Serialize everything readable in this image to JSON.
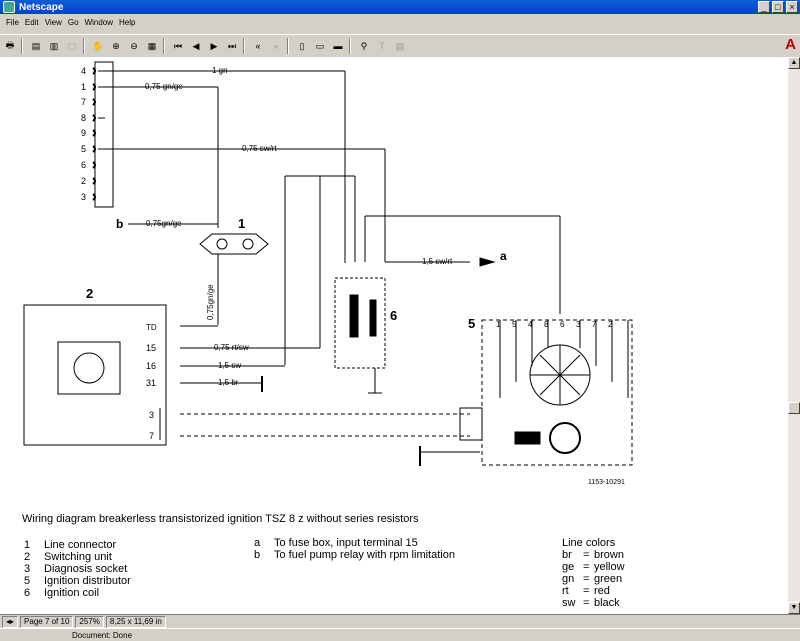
{
  "window": {
    "title": "Netscape",
    "controls": [
      "_",
      "□",
      "×"
    ]
  },
  "menu": [
    "File",
    "Edit",
    "View",
    "Go",
    "Window",
    "Help"
  ],
  "toolbar": {
    "icons": [
      "print-icon",
      "thumbnails-icon",
      "bookmarks-icon",
      "document-icon",
      "hand-icon",
      "zoom-in-icon",
      "zoom-out-icon",
      "select-icon",
      "first-page-icon",
      "previous-page-icon",
      "next-page-icon",
      "last-page-icon",
      "go-back-icon",
      "go-forward-icon",
      "actual-size-icon",
      "fit-page-icon",
      "fit-width-icon",
      "find-icon",
      "text-select-icon",
      "graphics-select-icon"
    ],
    "adobe_logo": "A"
  },
  "diagram": {
    "left_connector_pins": [
      "4",
      "1",
      "7",
      "8",
      "9",
      "5",
      "6",
      "2",
      "3"
    ],
    "wire_labels": {
      "w1": "1 gn",
      "w2": "0,75 gn/ge",
      "w3": "0,75 sw/rt",
      "b_wire": "0,75gn/ge",
      "a_wire": "1,5 sw/rt",
      "vertical": "0,75gn/ge",
      "td": "TD",
      "w15": "0,75 rt/sw",
      "w16": "1,5 sw",
      "w31": "1,5 br"
    },
    "labels": {
      "b": "b",
      "a": "a",
      "n1": "1",
      "n2": "2",
      "n5": "5",
      "n6": "6",
      "p15": "15",
      "p16": "16",
      "p31": "31",
      "p3": "3",
      "p7": "7"
    },
    "distributor_pins": [
      "1",
      "5",
      "4",
      "8",
      "6",
      "3",
      "7",
      "2"
    ],
    "ref_code": "1153-10291",
    "caption": "Wiring diagram breakerless transistorized ignition TSZ 8 z without series resistors",
    "legend_numbers": [
      {
        "num": "1",
        "text": "Line connector"
      },
      {
        "num": "2",
        "text": "Switching unit"
      },
      {
        "num": "3",
        "text": "Diagnosis socket"
      },
      {
        "num": "5",
        "text": "Ignition distributor"
      },
      {
        "num": "6",
        "text": "Ignition coil"
      }
    ],
    "legend_letters": [
      {
        "letter": "a",
        "text": "To fuse box, input terminal 15"
      },
      {
        "letter": "b",
        "text": "To fuel pump relay with rpm limitation"
      }
    ],
    "line_colors_title": "Line colors",
    "line_colors": [
      {
        "abbr": "br",
        "sep": "=",
        "name": "brown"
      },
      {
        "abbr": "ge",
        "sep": "=",
        "name": "yellow"
      },
      {
        "abbr": "gn",
        "sep": "=",
        "name": "green"
      },
      {
        "abbr": "rt",
        "sep": "=",
        "name": "red"
      },
      {
        "abbr": "sw",
        "sep": "=",
        "name": "black"
      }
    ]
  },
  "pdf_status": {
    "page": "Page 7 of 10",
    "zoom": "257%",
    "size": "8,25 x 11,69 in"
  },
  "status": {
    "message": "Document: Done"
  }
}
